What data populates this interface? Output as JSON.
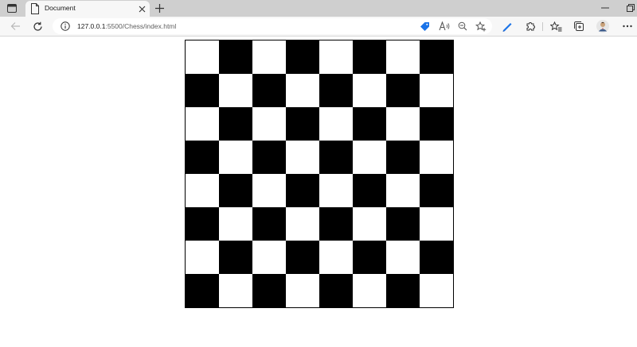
{
  "browser": {
    "tab": {
      "title": "Document"
    },
    "address_bar": {
      "host": "127.0.0.1",
      "rest": ":5500/Chess/index.html"
    }
  },
  "page": {
    "board": {
      "rows": 8,
      "columns": 8,
      "light_color": "#ffffff",
      "dark_color": "#000000",
      "top_left": "light"
    }
  }
}
